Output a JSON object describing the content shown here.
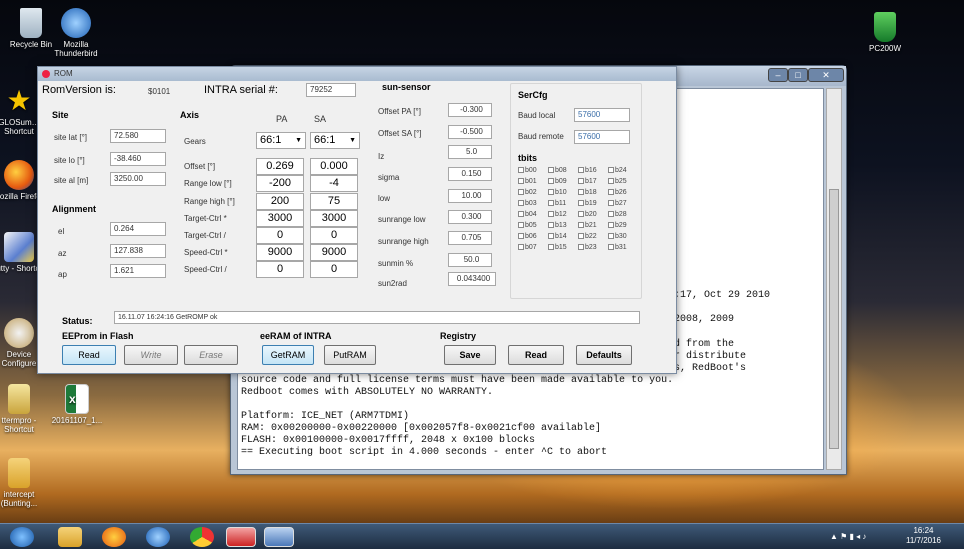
{
  "desktop": {
    "icons": [
      {
        "label": "Recycle Bin",
        "icon": "recycle-bin-icon"
      },
      {
        "label": "Mozilla Thunderbird",
        "icon": "thunderbird-icon"
      },
      {
        "label": "GLOSum… Shortcut",
        "icon": "star-icon"
      },
      {
        "label": "Mozilla Firefox",
        "icon": "firefox-icon"
      },
      {
        "label": "putty - Shortcut",
        "icon": "putty-icon"
      },
      {
        "label": "Device Configure",
        "icon": "device-config-icon"
      },
      {
        "label": "ttermpro - Shortcut",
        "icon": "ttermpro-icon"
      },
      {
        "label": "20161107_1...",
        "icon": "excel-file-icon"
      },
      {
        "label": "intercept (Bunting...",
        "icon": "folder-icon"
      },
      {
        "label": "PC200W",
        "icon": "pc200w-icon"
      }
    ]
  },
  "terminal": {
    "title": "",
    "lines": [
      ":17, Oct 29 2010",
      "2008, 2009",
      "d from the",
      "r distribute",
      "s, RedBoot's",
      "source code and full license terms must have been made available to you.",
      "Redboot comes with ABSOLUTELY NO WARRANTY.",
      "",
      "Platform: ICE_NET (ARM7TDMI)",
      "RAM: 0x00200000-0x00220000 [0x002057f8-0x0021cf00 available]",
      "FLASH: 0x00100000-0x0017ffff, 2048 x 0x100 blocks",
      "== Executing boot script in 4.000 seconds - enter ^C to abort"
    ]
  },
  "rom": {
    "title": "ROM",
    "rom_version_label": "RomVersion is:",
    "rom_version": "$0101",
    "serial_label": "INTRA serial #:",
    "serial": "79252",
    "site": {
      "heading": "Site",
      "lat_label": "site lat [°]",
      "lat": "72.580",
      "lon_label": "site lo [°]",
      "lon": "-38.460",
      "alt_label": "site al [m]",
      "alt": "3250.00"
    },
    "alignment": {
      "heading": "Alignment",
      "el_label": "el",
      "el": "0.264",
      "az_label": "az",
      "az": "127.838",
      "ap_label": "ap",
      "ap": "1.621"
    },
    "axis": {
      "heading": "Axis",
      "col_pa": "PA",
      "col_sa": "SA",
      "rows": [
        {
          "label": "Gears",
          "pa": "66:1",
          "sa": "66:1"
        },
        {
          "label": "Offset [°]",
          "pa": "0.269",
          "sa": "0.000"
        },
        {
          "label": "Range low [°]",
          "pa": "-200",
          "sa": "-4"
        },
        {
          "label": "Range high [°]",
          "pa": "200",
          "sa": "75"
        },
        {
          "label": "Target-Ctrl *",
          "pa": "3000",
          "sa": "3000"
        },
        {
          "label": "Target-Ctrl /",
          "pa": "0",
          "sa": "0"
        },
        {
          "label": "Speed-Ctrl *",
          "pa": "9000",
          "sa": "9000"
        },
        {
          "label": "Speed-Ctrl /",
          "pa": "0",
          "sa": "0"
        }
      ]
    },
    "sun_sensor": {
      "heading": "sun-sensor",
      "rows": [
        {
          "label": "Offset PA [°]",
          "value": "-0.300"
        },
        {
          "label": "Offset SA [°]",
          "value": "-0.500"
        },
        {
          "label": "Iz",
          "value": "5.0"
        },
        {
          "label": "sigma",
          "value": "0.150"
        },
        {
          "label": "low",
          "value": "10.00"
        },
        {
          "label": "sunrange low",
          "value": "0.300"
        },
        {
          "label": "sunrange high",
          "value": "0.705"
        },
        {
          "label": "sunmin %",
          "value": "50.0"
        },
        {
          "label": "sun2rad",
          "value": "0.043400"
        }
      ]
    },
    "sercfg": {
      "heading": "SerCfg",
      "baud_local_label": "Baud local",
      "baud_local": "57600",
      "baud_remote_label": "Baud remote",
      "baud_remote": "57600"
    },
    "tbits": {
      "heading": "tbits",
      "cols": [
        [
          "b00",
          "b01",
          "b02",
          "b03",
          "b04",
          "b05",
          "b06",
          "b07"
        ],
        [
          "b08",
          "b09",
          "b10",
          "b11",
          "b12",
          "b13",
          "b14",
          "b15"
        ],
        [
          "b16",
          "b17",
          "b18",
          "b19",
          "b20",
          "b21",
          "b22",
          "b23"
        ],
        [
          "b24",
          "b25",
          "b26",
          "b27",
          "b28",
          "b29",
          "b30",
          "b31"
        ]
      ]
    },
    "status_label": "Status:",
    "status_text": "16.11.07 16:24:16 GetROMP ok",
    "eeprom": {
      "heading": "EEProm in Flash",
      "read": "Read",
      "write": "Write",
      "erase": "Erase"
    },
    "eeram": {
      "heading": "eeRAM of INTRA",
      "get": "GetRAM",
      "put": "PutRAM"
    },
    "registry": {
      "heading": "Registry",
      "save": "Save",
      "read": "Read",
      "defaults": "Defaults"
    }
  },
  "taskbar": {
    "time": "16:24",
    "date": "11/7/2016"
  }
}
